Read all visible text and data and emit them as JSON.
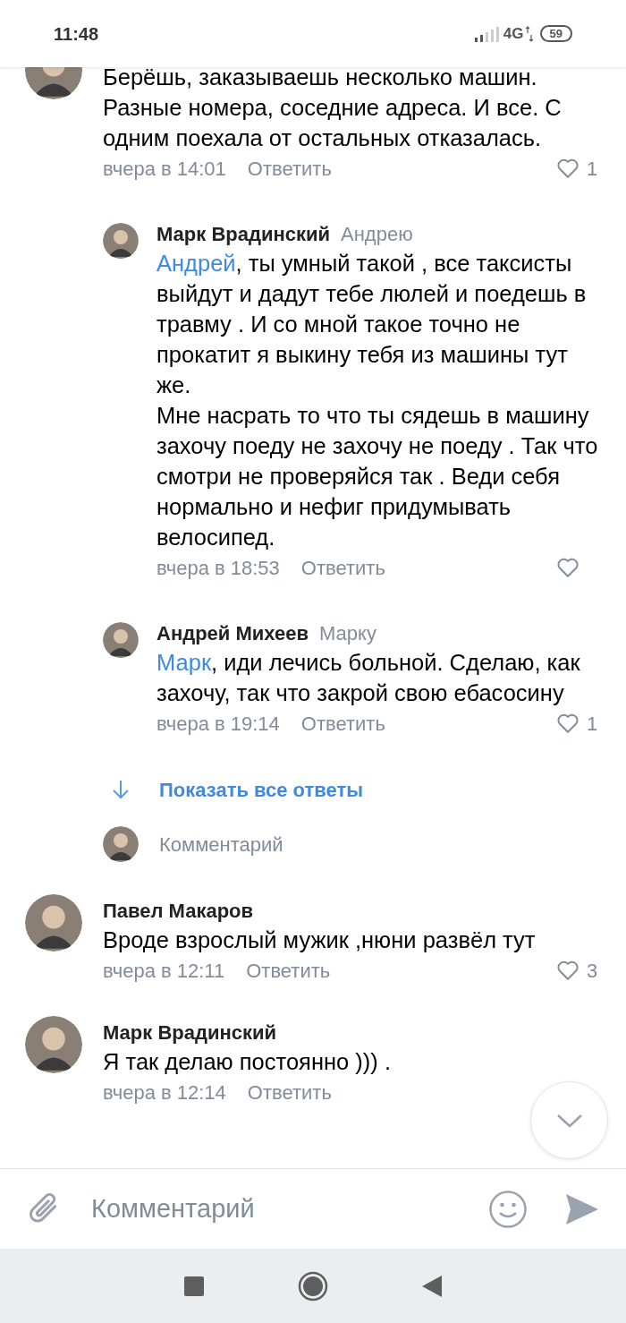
{
  "status_bar": {
    "time": "11:48",
    "network": "4G",
    "battery": "59"
  },
  "comments": [
    {
      "kind": "cut",
      "text": "Берёшь, заказываешь несколько машин. Разные номера, соседние адреса. И все. С одним поехала от остальных отказалась.",
      "time": "вчера в 14:01",
      "reply": "Ответить",
      "like_button": true,
      "likes": "1"
    },
    {
      "kind": "reply",
      "author": "Марк Врадинский",
      "reply_to": "Андрею",
      "mention": "Андрей",
      "text": ", ты умный такой , все таксисты выйдут и дадут тебе люлей и поедешь в травму . И со мной такое точно не прокатит я выкину тебя  из машины тут же.\nМне насрать то что ты сядешь в машину захочу поеду не захочу не поеду . Так что смотри не проверяйся так . Веди себя нормально и нефиг придумывать велосипед.",
      "time": "вчера в 18:53",
      "reply": "Ответить",
      "like_button": true
    },
    {
      "kind": "reply",
      "author": "Андрей Михеев",
      "reply_to": "Марку",
      "mention": "Марк",
      "text": ", иди лечись больной. Сделаю, как захочу, так что закрой свою ебасосину",
      "time": "вчера в 19:14",
      "reply": "Ответить",
      "like_button": true,
      "likes": "1"
    },
    {
      "kind": "show_all",
      "text": "Показать все ответы"
    },
    {
      "kind": "input",
      "placeholder": "Комментарий"
    },
    {
      "kind": "top",
      "author": "Павел Макаров",
      "text": "Вроде взрослый мужик ,нюни развёл тут",
      "time": "вчера в 12:11",
      "reply": "Ответить",
      "like_button": true,
      "likes": "3"
    },
    {
      "kind": "top",
      "author": "Марк Врадинский",
      "text": "Я так делаю постоянно ))) .",
      "time": "вчера в 12:14",
      "reply": "Ответить",
      "like_button": false
    }
  ],
  "composer": {
    "placeholder": "Комментарий"
  }
}
